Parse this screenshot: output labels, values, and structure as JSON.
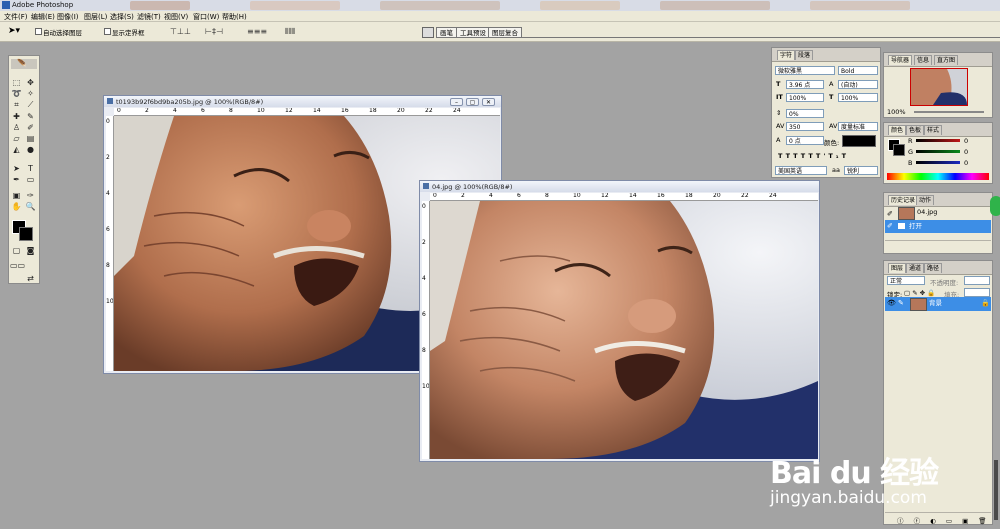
{
  "app": {
    "title": "Adobe Photoshop"
  },
  "menu": [
    "文件(F)",
    "编辑(E)",
    "图像(I)",
    "图层(L)",
    "选择(S)",
    "滤镜(T)",
    "视图(V)",
    "窗口(W)",
    "帮助(H)"
  ],
  "options": {
    "auto_select": "自动选择图层",
    "show_bounds": "显示定界框",
    "well_tabs": [
      "画笔",
      "工具预设",
      "图层复合"
    ]
  },
  "doc1": {
    "title": "t0193b92f6bd9ba205b.jpg @ 100%(RGB/8#)",
    "ruler_h": [
      "0",
      "2",
      "4",
      "6",
      "8",
      "10",
      "12",
      "14",
      "16",
      "18",
      "20",
      "22",
      "24"
    ],
    "ruler_v": [
      "0",
      "2",
      "4",
      "6",
      "8",
      "10"
    ]
  },
  "doc2": {
    "title": "04.jpg @ 100%(RGB/8#)",
    "ruler_h": [
      "0",
      "2",
      "4",
      "6",
      "8",
      "10",
      "12",
      "14",
      "16",
      "18",
      "20",
      "22",
      "24"
    ],
    "ruler_v": [
      "0",
      "2",
      "4",
      "6",
      "8",
      "10"
    ]
  },
  "char_panel": {
    "tabs": [
      "字符",
      "段落"
    ],
    "font_family": "微软雅黑",
    "font_style": "Bold",
    "size": "3.96 点",
    "leading": "(自动)",
    "vscale": "100%",
    "hscale": "100%",
    "baseline": "0%",
    "tracking": "350",
    "kerning": "度量标准",
    "shift": "0 点",
    "color_label": "颜色:",
    "lang": "美国英语",
    "aa": "锐利"
  },
  "navigator": {
    "tabs": [
      "导航器",
      "信息",
      "直方图"
    ],
    "zoom": "100%"
  },
  "color_panel": {
    "tabs": [
      "颜色",
      "色板",
      "样式"
    ],
    "channels": [
      {
        "label": "R",
        "value": "0",
        "color": "#c01818"
      },
      {
        "label": "G",
        "value": "0",
        "color": "#0a8a1a"
      },
      {
        "label": "B",
        "value": "0",
        "color": "#1a2ac0"
      }
    ]
  },
  "history": {
    "tabs": [
      "历史记录",
      "动作"
    ],
    "items": [
      "04.jpg",
      "打开"
    ]
  },
  "layers": {
    "tabs": [
      "图层",
      "通道",
      "路径"
    ],
    "mode": "正常",
    "opacity_label": "不透明度:",
    "lock_label": "锁定:",
    "fill_label": "填充:",
    "layer_name": "背景"
  },
  "watermark": {
    "brand": "Bai du 经验",
    "url": "jingyan.baidu.com"
  }
}
